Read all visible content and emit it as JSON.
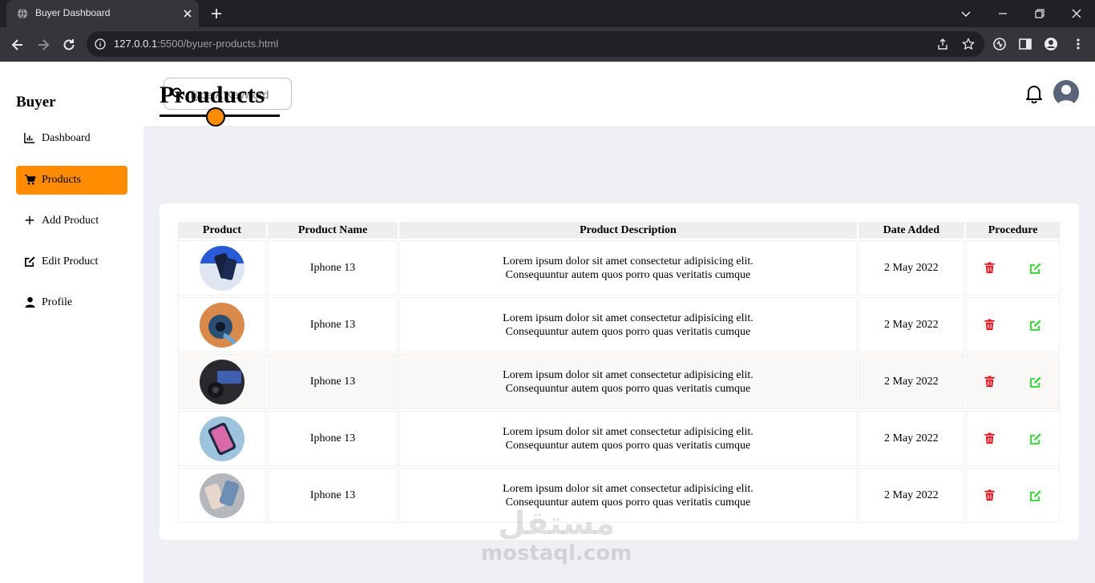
{
  "browser": {
    "tab_title": "Buyer Dashboard",
    "url_host": "127.0.0.1",
    "url_rest": ":5500/byuer-products.html"
  },
  "sidebar": {
    "brand": "Buyer",
    "items": [
      {
        "label": "Dashboard",
        "icon": "chart-icon"
      },
      {
        "label": "Products",
        "icon": "cart-icon",
        "active": true
      },
      {
        "label": "Add Product",
        "icon": "plus-icon"
      },
      {
        "label": "Edit Product",
        "icon": "edit-icon"
      },
      {
        "label": "Profile",
        "icon": "user-icon"
      }
    ]
  },
  "header": {
    "search_placeholder": "Type A Keyword"
  },
  "main": {
    "title": "Prouducts"
  },
  "table": {
    "columns": [
      "Product",
      "Product Name",
      "Product Description",
      "Date Added",
      "Procedure"
    ],
    "rows": [
      {
        "name": "Iphone 13",
        "desc1": "Lorem ipsum dolor sit amet consectetur adipisicing elit.",
        "desc2": "Consequuntur autem quos porro quas veritatis cumque",
        "date": "2 May 2022"
      },
      {
        "name": "Iphone 13",
        "desc1": "Lorem ipsum dolor sit amet consectetur adipisicing elit.",
        "desc2": "Consequuntur autem quos porro quas veritatis cumque",
        "date": "2 May 2022"
      },
      {
        "name": "Iphone 13",
        "desc1": "Lorem ipsum dolor sit amet consectetur adipisicing elit.",
        "desc2": "Consequuntur autem quos porro quas veritatis cumque",
        "date": "2 May 2022"
      },
      {
        "name": "Iphone 13",
        "desc1": "Lorem ipsum dolor sit amet consectetur adipisicing elit.",
        "desc2": "Consequuntur autem quos porro quas veritatis cumque",
        "date": "2 May 2022"
      },
      {
        "name": "Iphone 13",
        "desc1": "Lorem ipsum dolor sit amet consectetur adipisicing elit.",
        "desc2": "Consequuntur autem quos porro quas veritatis cumque",
        "date": "2 May 2022"
      }
    ]
  },
  "watermark": {
    "arabic": "مستقل",
    "latin": "mostaql.com"
  },
  "colors": {
    "accent": "#ff8c00",
    "delete": "#e8101a",
    "edit": "#22dd22"
  }
}
